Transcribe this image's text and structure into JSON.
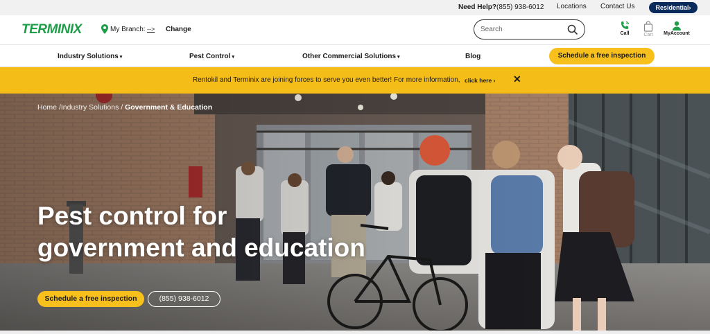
{
  "topbar": {
    "help_label": "Need Help?",
    "phone": "(855) 938-6012",
    "locations": "Locations",
    "contact": "Contact Us",
    "residential": "Residential›"
  },
  "header": {
    "logo": "TERMINIX",
    "branch_label": "My Branch:",
    "branch_value": "-->",
    "change": "Change",
    "search_placeholder": "Search",
    "call": "Call",
    "cart": "Cart",
    "account": "MyAccount"
  },
  "nav": {
    "items": [
      {
        "label": "Industry Solutions",
        "caret": "▾"
      },
      {
        "label": "Pest Control",
        "caret": "▾"
      },
      {
        "label": "Other Commercial Solutions",
        "caret": "▾"
      },
      {
        "label": "Blog",
        "caret": ""
      }
    ],
    "cta": "Schedule a free inspection"
  },
  "banner": {
    "message": "Rentokil and Terminix are joining forces to serve you even better! For more information,",
    "link": "click here ›",
    "close": "✕"
  },
  "breadcrumb": {
    "home": "Home",
    "section": "Industry Solutions",
    "current": "Government & Education"
  },
  "hero": {
    "title_line1": "Pest control for",
    "title_line2": "government and education",
    "cta": "Schedule a free inspection",
    "phone": "(855) 938-6012"
  },
  "colors": {
    "brand_green": "#1e9e48",
    "accent_yellow": "#f7c01c",
    "banner_yellow": "#f5bd17",
    "navy": "#0b2a5c"
  },
  "icons": [
    "map-pin-icon",
    "search-icon",
    "phone-icon",
    "cart-icon",
    "account-icon",
    "close-icon"
  ]
}
